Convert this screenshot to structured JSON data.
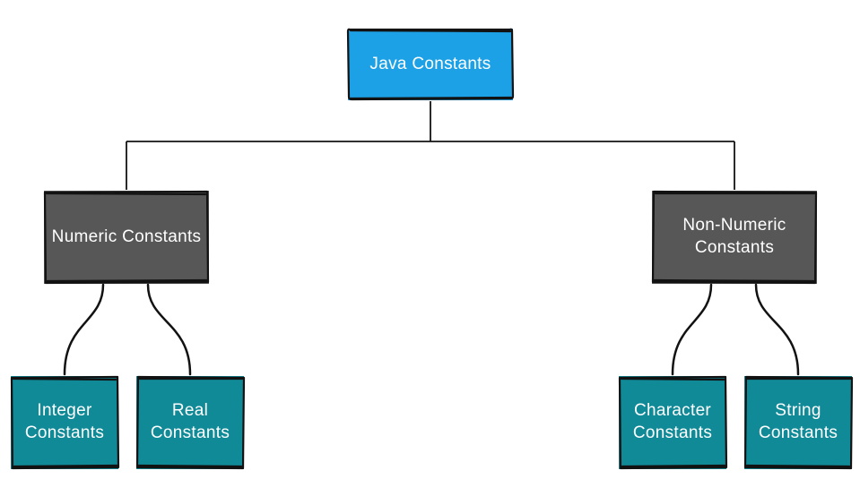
{
  "chart_data": {
    "type": "tree",
    "root": {
      "label": "Java Constants",
      "color": "#1da1e6",
      "children": [
        {
          "label": "Numeric Constants",
          "color": "#575757",
          "children": [
            {
              "label": "Integer Constants",
              "color": "#118a98"
            },
            {
              "label": "Real Constants",
              "color": "#118a98"
            }
          ]
        },
        {
          "label": "Non-Numeric Constants",
          "color": "#575757",
          "children": [
            {
              "label": "Character Constants",
              "color": "#118a98"
            },
            {
              "label": "String Constants",
              "color": "#118a98"
            }
          ]
        }
      ]
    }
  },
  "nodes": {
    "root": "Java Constants",
    "numeric": "Numeric Constants",
    "nonnumeric": "Non-Numeric\nConstants",
    "integer": "Integer\nConstants",
    "real": "Real\nConstants",
    "character": "Character\nConstants",
    "string": "String\nConstants"
  },
  "colors": {
    "blue": "#1da1e6",
    "gray": "#575757",
    "teal": "#118a98",
    "stroke": "#121212"
  }
}
